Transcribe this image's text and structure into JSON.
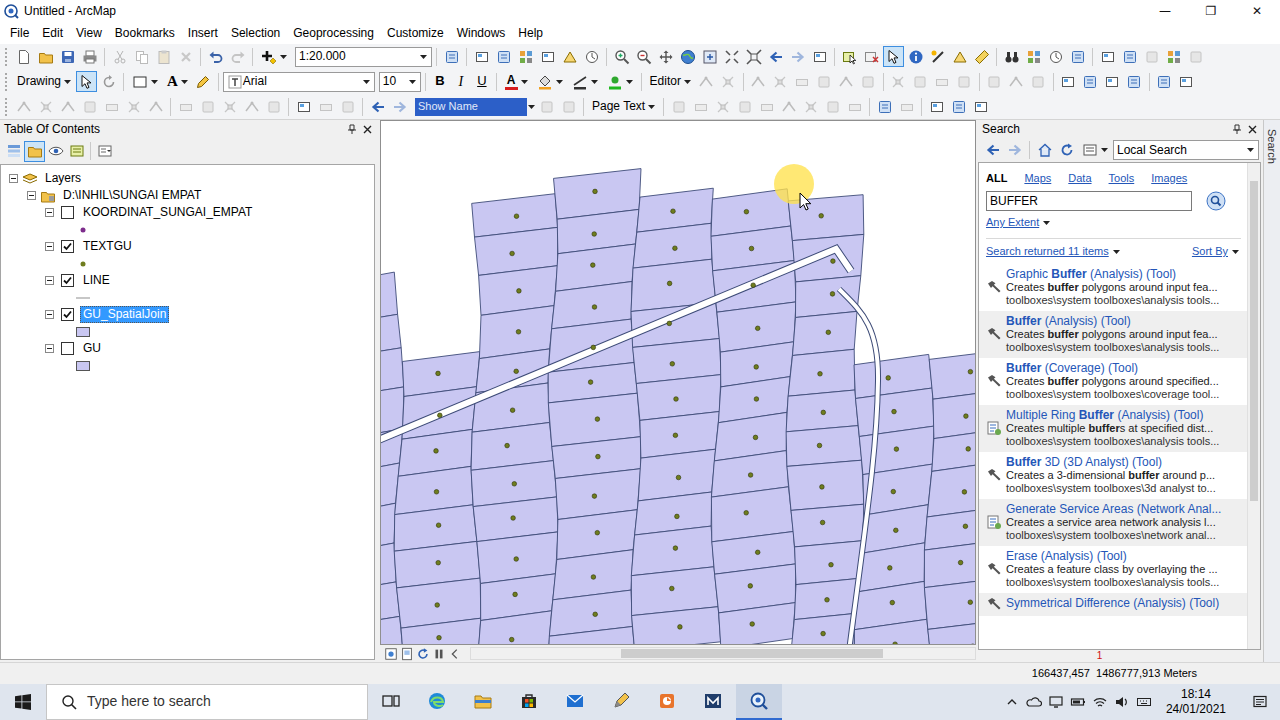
{
  "window": {
    "title": "Untitled - ArcMap",
    "minimize": "—",
    "maximize": "❐",
    "close": "✕"
  },
  "menu": [
    "File",
    "Edit",
    "View",
    "Bookmarks",
    "Insert",
    "Selection",
    "Geoprocessing",
    "Customize",
    "Windows",
    "Help"
  ],
  "toolbar": {
    "scale": "1:20.000",
    "drawing": "Drawing",
    "text_tool": "A",
    "font": "Arial",
    "font_size": "10",
    "bold": "B",
    "italic": "I",
    "underline": "U",
    "font_color": "A",
    "editor": "Editor",
    "show_name": "Show Name",
    "page_text": "Page Text",
    "pressed": {
      "select_elements": true,
      "drawing_pointer": true
    }
  },
  "toc": {
    "title": "Table Of Contents",
    "list_by_drawing_order": true,
    "tree": {
      "root": {
        "label": "Layers",
        "expanded": true
      },
      "group": {
        "label": "D:\\INHIL\\SUNGAI EMPAT",
        "expanded": true
      },
      "layers": [
        {
          "name": "KOORDINAT_SUNGAI_EMPAT",
          "checked": false,
          "selected": false,
          "expanded": true,
          "kind": "point",
          "color": "#7d2d8c"
        },
        {
          "name": "TEXTGU",
          "checked": true,
          "selected": false,
          "expanded": true,
          "kind": "point",
          "color": "#6f7d1e"
        },
        {
          "name": "LINE",
          "checked": true,
          "selected": false,
          "expanded": true,
          "kind": "line",
          "color": "#b4b4b4"
        },
        {
          "name": "GU_SpatialJoin",
          "checked": true,
          "selected": true,
          "expanded": true,
          "kind": "polygon",
          "color": "#c9c7f2"
        },
        {
          "name": "GU",
          "checked": false,
          "selected": false,
          "expanded": true,
          "kind": "polygon",
          "color": "#c9c7f2"
        }
      ]
    }
  },
  "search": {
    "title": "Search",
    "scope": "Local Search",
    "side_tab": "Search",
    "tabs": [
      {
        "label": "ALL",
        "selected": true
      },
      {
        "label": "Maps",
        "selected": false
      },
      {
        "label": "Data",
        "selected": false
      },
      {
        "label": "Tools",
        "selected": false
      },
      {
        "label": "Images",
        "selected": false
      }
    ],
    "query": "BUFFER",
    "extent": "Any Extent",
    "count": "Search returned 11 items",
    "sort": "Sort By",
    "results": [
      {
        "kind": "tool",
        "title": [
          {
            "text": "Graphic ",
            "match": false
          },
          {
            "text": "Buffer",
            "match": true
          },
          {
            "text": " (Analysis) (Tool)",
            "match": false
          }
        ],
        "desc": [
          {
            "text": "Creates ",
            "match": false
          },
          {
            "text": "buffer",
            "match": true
          },
          {
            "text": " polygons around input fea...",
            "match": false
          }
        ],
        "path": "toolboxes\\system toolboxes\\analysis tools..."
      },
      {
        "kind": "tool",
        "title": [
          {
            "text": "Buffer",
            "match": true
          },
          {
            "text": " (Analysis) (Tool)",
            "match": false
          }
        ],
        "desc": [
          {
            "text": "Creates ",
            "match": false
          },
          {
            "text": "buffer",
            "match": true
          },
          {
            "text": " polygons around input fea...",
            "match": false
          }
        ],
        "path": "toolboxes\\system toolboxes\\analysis tools..."
      },
      {
        "kind": "tool",
        "title": [
          {
            "text": "Buffer",
            "match": true
          },
          {
            "text": " (Coverage) (Tool)",
            "match": false
          }
        ],
        "desc": [
          {
            "text": "Creates ",
            "match": false
          },
          {
            "text": "buffer",
            "match": true
          },
          {
            "text": " polygons around specified...",
            "match": false
          }
        ],
        "path": "toolboxes\\system toolboxes\\coverage tool..."
      },
      {
        "kind": "script",
        "title": [
          {
            "text": "Multiple Ring ",
            "match": false
          },
          {
            "text": "Buffer",
            "match": true
          },
          {
            "text": " (Analysis) (Tool)",
            "match": false
          }
        ],
        "desc": [
          {
            "text": "Creates multiple ",
            "match": false
          },
          {
            "text": "buffer",
            "match": true
          },
          {
            "text": "s at specified dist...",
            "match": false
          }
        ],
        "path": "toolboxes\\system toolboxes\\analysis tools..."
      },
      {
        "kind": "tool",
        "title": [
          {
            "text": "Buffer",
            "match": true
          },
          {
            "text": " 3D (3D Analyst) (Tool)",
            "match": false
          }
        ],
        "desc": [
          {
            "text": "Creates a 3-dimensional ",
            "match": false
          },
          {
            "text": "buffer",
            "match": true
          },
          {
            "text": " around p...",
            "match": false
          }
        ],
        "path": "toolboxes\\system toolboxes\\3d analyst to..."
      },
      {
        "kind": "script",
        "title": [
          {
            "text": "Generate Service Areas (Network Anal...",
            "match": false
          }
        ],
        "desc": [
          {
            "text": "Creates a service area network analysis l...",
            "match": false
          }
        ],
        "path": "toolboxes\\system toolboxes\\network anal..."
      },
      {
        "kind": "tool",
        "title": [
          {
            "text": "Erase (Analysis) (Tool)",
            "match": false
          }
        ],
        "desc": [
          {
            "text": "Creates a feature class by overlaying the ...",
            "match": false
          }
        ],
        "path": "toolboxes\\system toolboxes\\analysis tools..."
      },
      {
        "kind": "tool",
        "title": [
          {
            "text": "Symmetrical Difference (Analysis) (Tool)",
            "match": false
          }
        ]
      }
    ],
    "page": "1"
  },
  "status": {
    "coordinates": "166437,457  1486777,913 Meters"
  },
  "taskbar": {
    "search_placeholder": "Type here to search",
    "time": "18:14",
    "date": "24/01/2021",
    "apps": [
      {
        "kind": "taskview",
        "selected": false
      },
      {
        "kind": "edge",
        "selected": false
      },
      {
        "kind": "explorer",
        "selected": false
      },
      {
        "kind": "store",
        "selected": false
      },
      {
        "kind": "mail",
        "selected": false
      },
      {
        "kind": "pen",
        "selected": false
      },
      {
        "kind": "slides",
        "selected": false
      },
      {
        "kind": "mathcad",
        "selected": false
      },
      {
        "kind": "arcmap",
        "selected": true
      }
    ]
  }
}
